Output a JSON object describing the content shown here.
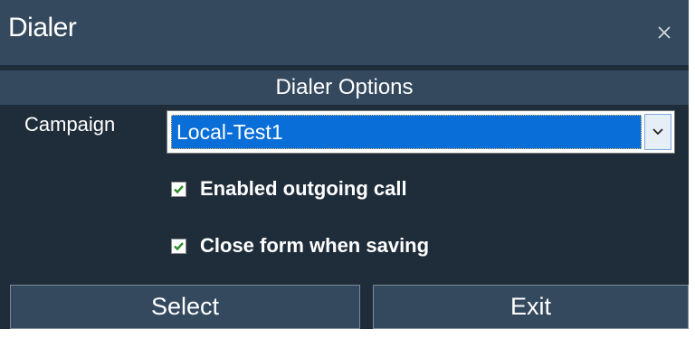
{
  "window": {
    "title": "Dialer",
    "close_icon": "close-icon"
  },
  "section": {
    "title": "Dialer Options"
  },
  "campaign": {
    "label": "Campaign",
    "selected": "Local-Test1",
    "dropdown_icon": "chevron-down-icon"
  },
  "options": [
    {
      "label": "Enabled outgoing call",
      "checked": true
    },
    {
      "label": "Close form when saving",
      "checked": true
    }
  ],
  "buttons": {
    "select_label": "Select",
    "exit_label": "Exit"
  },
  "colors": {
    "window_bg": "#1f2d3b",
    "header_bg": "#34495e",
    "selection_blue": "#0a6ed9",
    "check_green": "#2e8b2e"
  }
}
